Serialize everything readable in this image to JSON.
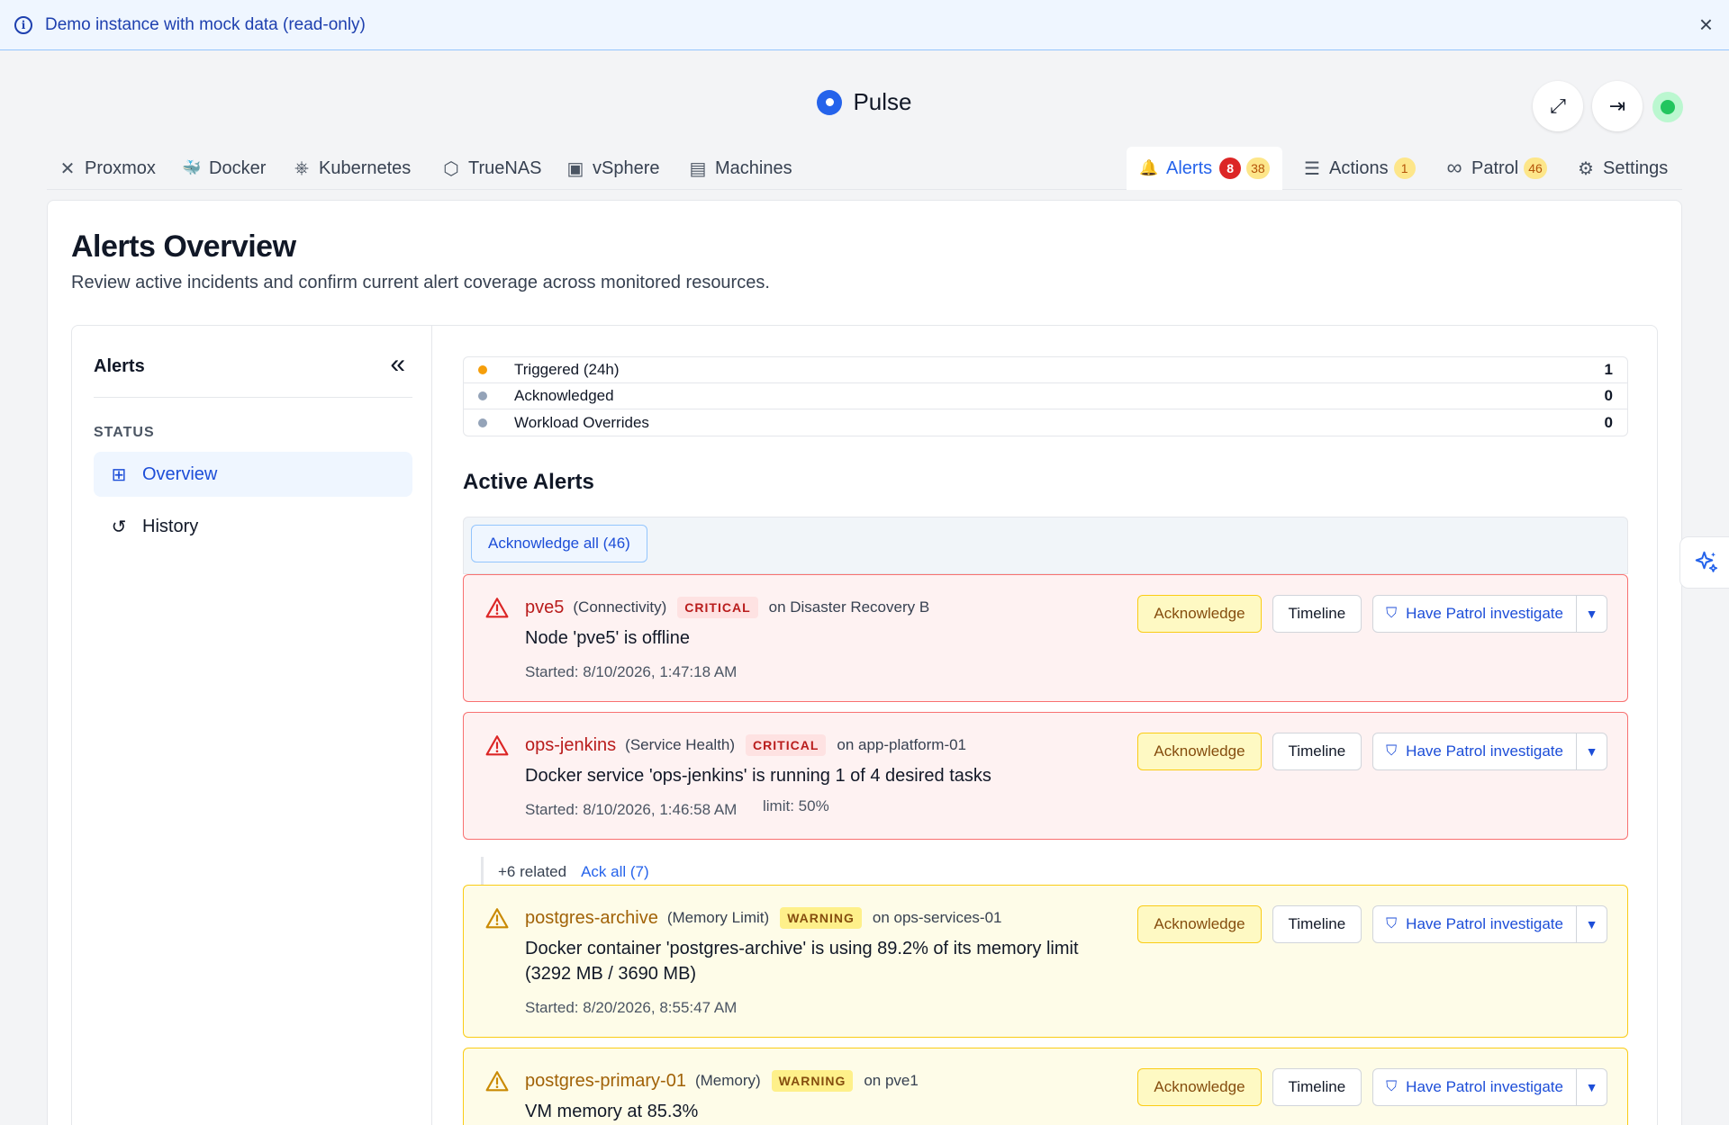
{
  "banner": {
    "text": "Demo instance with mock data (read-only)",
    "close": "×"
  },
  "brand": {
    "name": "Pulse"
  },
  "header_icons": {
    "expand": "⤢",
    "logout": "⇥"
  },
  "nav": {
    "left": [
      {
        "label": "Proxmox",
        "icon": "✕"
      },
      {
        "label": "Docker",
        "icon": "🐳"
      },
      {
        "label": "Kubernetes",
        "icon": "⎈"
      },
      {
        "label": "TrueNAS",
        "icon": "⬡"
      },
      {
        "label": "vSphere",
        "icon": "▣"
      },
      {
        "label": "Machines",
        "icon": "▤"
      }
    ],
    "alerts": {
      "label": "Alerts",
      "icon": "🔔",
      "red": "8",
      "yellow": "38"
    },
    "actions": {
      "label": "Actions",
      "icon": "☰",
      "yellow": "1"
    },
    "patrol": {
      "label": "Patrol",
      "icon": "∞",
      "yellow": "46"
    },
    "settings": {
      "label": "Settings",
      "icon": "⚙"
    }
  },
  "page": {
    "title": "Alerts Overview",
    "subtitle": "Review active incidents and confirm current alert coverage across monitored resources."
  },
  "sidebar": {
    "title": "Alerts",
    "collapse": "«",
    "section": "STATUS",
    "items": [
      {
        "label": "Overview",
        "icon": "⊞"
      },
      {
        "label": "History",
        "icon": "↺"
      }
    ]
  },
  "stats": [
    {
      "label": "Triggered (24h)",
      "value": "1",
      "color": "#f59e0b"
    },
    {
      "label": "Acknowledged",
      "value": "0",
      "color": "#94a3b8"
    },
    {
      "label": "Workload Overrides",
      "value": "0",
      "color": "#94a3b8"
    }
  ],
  "active_alerts": {
    "title": "Active Alerts",
    "ack_all": "Acknowledge all (46)",
    "buttons": {
      "ack": "Acknowledge",
      "timeline": "Timeline",
      "patrol": "Have Patrol investigate"
    },
    "items": [
      {
        "resource": "pve5",
        "type": "(Connectivity)",
        "severity": "CRITICAL",
        "on": "on Disaster Recovery B",
        "message": "Node 'pve5' is offline",
        "started": "Started: 8/10/2026, 1:47:18 AM"
      },
      {
        "resource": "ops-jenkins",
        "type": "(Service Health)",
        "severity": "CRITICAL",
        "on": "on app-platform-01",
        "message": "Docker service 'ops-jenkins' is running 1 of 4 desired tasks",
        "started": "Started: 8/10/2026, 1:46:58 AM",
        "limit": "limit: 50%"
      },
      {
        "resource": "postgres-archive",
        "type": "(Memory Limit)",
        "severity": "WARNING",
        "on": "on ops-services-01",
        "message": "Docker container 'postgres-archive' is using 89.2% of its memory limit (3292 MB / 3690 MB)",
        "started": "Started: 8/20/2026, 8:55:47 AM"
      },
      {
        "resource": "postgres-primary-01",
        "type": "(Memory)",
        "severity": "WARNING",
        "on": "on pve1",
        "message": "VM memory at 85.3%"
      }
    ],
    "related": {
      "count": "+6 related",
      "ack": "Ack all (7)"
    }
  }
}
